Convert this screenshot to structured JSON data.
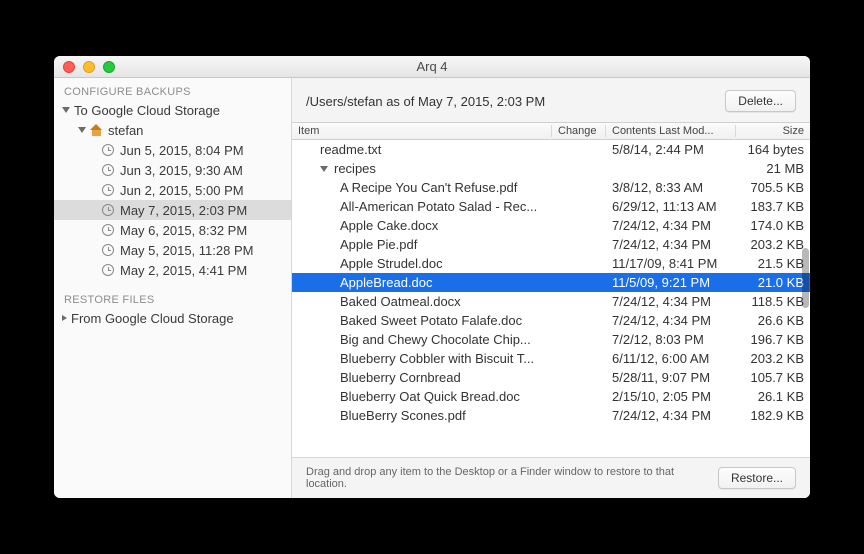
{
  "title": "Arq 4",
  "sidebar": {
    "configure_label": "CONFIGURE BACKUPS",
    "restore_label": "RESTORE FILES",
    "target": "To Google Cloud Storage",
    "account": "stefan",
    "snapshots": [
      "Jun 5, 2015, 8:04 PM",
      "Jun 3, 2015, 9:30 AM",
      "Jun 2, 2015, 5:00 PM",
      "May 7, 2015, 2:03 PM",
      "May 6, 2015, 8:32 PM",
      "May 5, 2015, 11:28 PM",
      "May 2, 2015, 4:41 PM"
    ],
    "selected_index": 3,
    "restore_source": "From Google Cloud Storage"
  },
  "header": {
    "path": "/Users/stefan as of May 7, 2015, 2:03 PM",
    "delete_label": "Delete..."
  },
  "columns": {
    "item": "Item",
    "change": "Change",
    "mod": "Contents Last Mod...",
    "size": "Size"
  },
  "rows": [
    {
      "indent": 1,
      "tri": "",
      "name": "readme.txt",
      "mod": "5/8/14, 2:44 PM",
      "size": "164 bytes"
    },
    {
      "indent": 1,
      "tri": "down",
      "name": "recipes",
      "mod": "",
      "size": "21 MB"
    },
    {
      "indent": 2,
      "tri": "",
      "name": "A Recipe You Can't Refuse.pdf",
      "mod": "3/8/12, 8:33 AM",
      "size": "705.5 KB"
    },
    {
      "indent": 2,
      "tri": "",
      "name": "All-American Potato Salad - Rec...",
      "mod": "6/29/12, 11:13 AM",
      "size": "183.7 KB"
    },
    {
      "indent": 2,
      "tri": "",
      "name": "Apple Cake.docx",
      "mod": "7/24/12, 4:34 PM",
      "size": "174.0 KB"
    },
    {
      "indent": 2,
      "tri": "",
      "name": "Apple Pie.pdf",
      "mod": "7/24/12, 4:34 PM",
      "size": "203.2 KB"
    },
    {
      "indent": 2,
      "tri": "",
      "name": "Apple Strudel.doc",
      "mod": "11/17/09, 8:41 PM",
      "size": "21.5 KB"
    },
    {
      "indent": 2,
      "tri": "",
      "name": "AppleBread.doc",
      "mod": "11/5/09, 9:21 PM",
      "size": "21.0 KB",
      "selected": true
    },
    {
      "indent": 2,
      "tri": "",
      "name": "Baked Oatmeal.docx",
      "mod": "7/24/12, 4:34 PM",
      "size": "118.5 KB"
    },
    {
      "indent": 2,
      "tri": "",
      "name": "Baked Sweet Potato Falafe.doc",
      "mod": "7/24/12, 4:34 PM",
      "size": "26.6 KB"
    },
    {
      "indent": 2,
      "tri": "",
      "name": "Big and Chewy Chocolate Chip...",
      "mod": "7/2/12, 8:03 PM",
      "size": "196.7 KB"
    },
    {
      "indent": 2,
      "tri": "",
      "name": "Blueberry Cobbler with Biscuit T...",
      "mod": "6/11/12, 6:00 AM",
      "size": "203.2 KB"
    },
    {
      "indent": 2,
      "tri": "",
      "name": "Blueberry Cornbread",
      "mod": "5/28/11, 9:07 PM",
      "size": "105.7 KB"
    },
    {
      "indent": 2,
      "tri": "",
      "name": "Blueberry Oat Quick Bread.doc",
      "mod": "2/15/10, 2:05 PM",
      "size": "26.1 KB"
    },
    {
      "indent": 2,
      "tri": "",
      "name": "BlueBerry Scones.pdf",
      "mod": "7/24/12, 4:34 PM",
      "size": "182.9 KB"
    }
  ],
  "footer": {
    "hint": "Drag and drop any item to the Desktop or a Finder window to restore to that location.",
    "restore_label": "Restore..."
  }
}
